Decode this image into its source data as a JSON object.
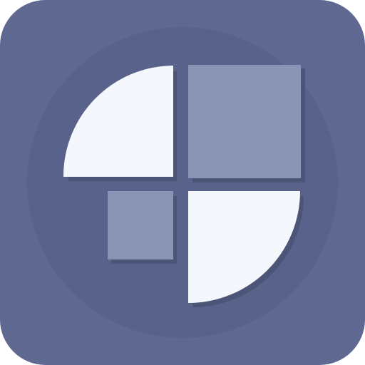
{
  "icon": {
    "name": "app-icon-quadrant-logo",
    "colors": {
      "tile_background": "#5e6891",
      "inner_circle": "#58628a",
      "shadow": "#4c5577",
      "light_shape": "#f4f8fd",
      "muted_shape": "#8a94b5"
    }
  }
}
